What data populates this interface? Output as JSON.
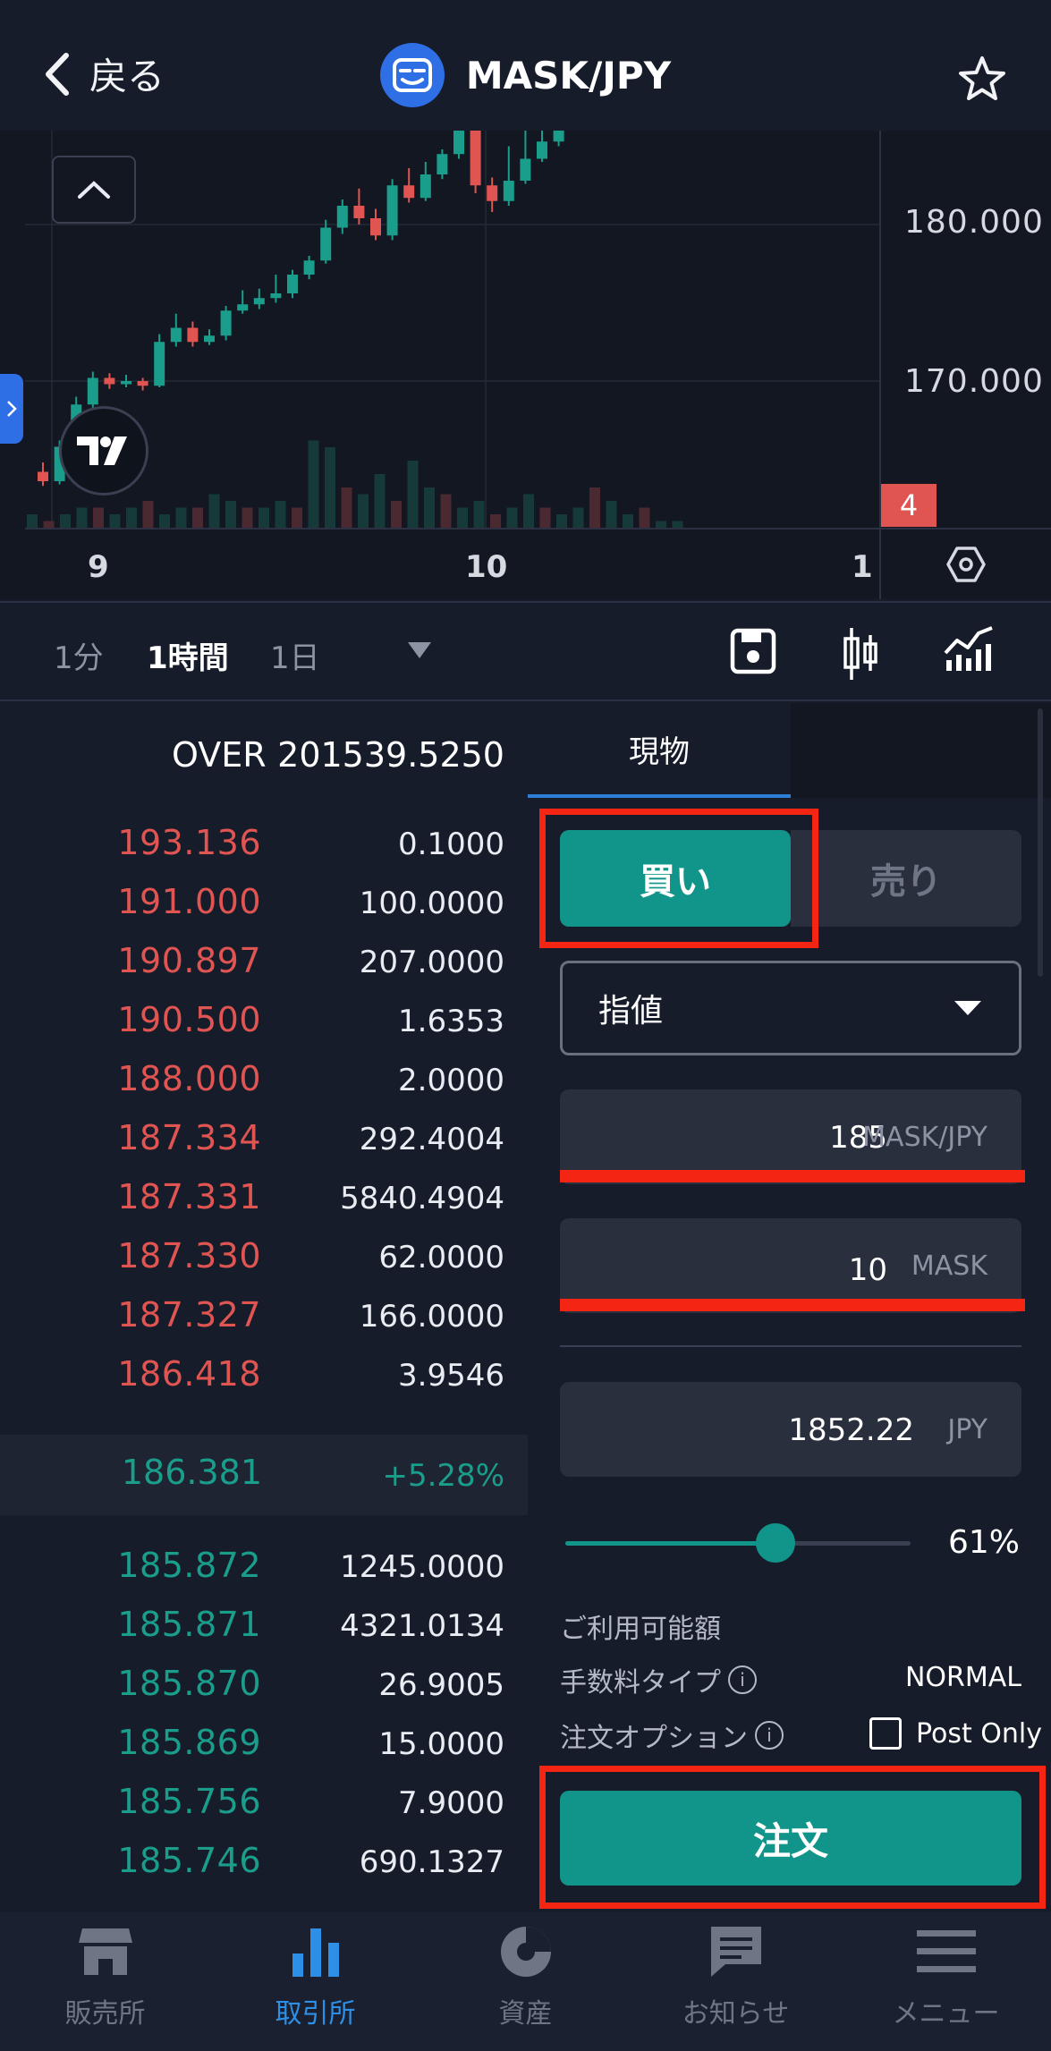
{
  "header": {
    "back_label": "戻る",
    "pair": "MASK/JPY"
  },
  "chart": {
    "y_labels": [
      "180.000",
      "170.000"
    ],
    "x_labels": [
      "9",
      "10",
      "1"
    ],
    "last_price_tag": "4",
    "candles": [
      {
        "o": 164.2,
        "c": 163.6,
        "h": 164.8,
        "l": 163.3
      },
      {
        "o": 163.6,
        "c": 165.8,
        "h": 166.2,
        "l": 163.4
      },
      {
        "o": 165.8,
        "c": 168.5,
        "h": 169.0,
        "l": 165.5
      },
      {
        "o": 168.5,
        "c": 170.2,
        "h": 170.6,
        "l": 168.2
      },
      {
        "o": 170.2,
        "c": 169.8,
        "h": 170.5,
        "l": 169.5
      },
      {
        "o": 169.8,
        "c": 170.0,
        "h": 170.4,
        "l": 169.6
      },
      {
        "o": 170.0,
        "c": 169.7,
        "h": 170.2,
        "l": 169.4
      },
      {
        "o": 169.7,
        "c": 172.5,
        "h": 173.0,
        "l": 169.6
      },
      {
        "o": 172.5,
        "c": 173.4,
        "h": 174.3,
        "l": 172.2
      },
      {
        "o": 173.4,
        "c": 172.5,
        "h": 173.8,
        "l": 172.2
      },
      {
        "o": 172.5,
        "c": 172.9,
        "h": 173.3,
        "l": 172.3
      },
      {
        "o": 172.9,
        "c": 174.5,
        "h": 174.8,
        "l": 172.6
      },
      {
        "o": 174.5,
        "c": 174.9,
        "h": 175.8,
        "l": 174.3
      },
      {
        "o": 174.9,
        "c": 175.3,
        "h": 175.9,
        "l": 174.6
      },
      {
        "o": 175.3,
        "c": 175.6,
        "h": 176.8,
        "l": 175.0
      },
      {
        "o": 175.6,
        "c": 176.8,
        "h": 177.1,
        "l": 175.3
      },
      {
        "o": 176.8,
        "c": 177.7,
        "h": 178.0,
        "l": 176.5
      },
      {
        "o": 177.7,
        "c": 179.8,
        "h": 180.3,
        "l": 177.5
      },
      {
        "o": 179.8,
        "c": 181.2,
        "h": 181.6,
        "l": 179.4
      },
      {
        "o": 181.2,
        "c": 180.4,
        "h": 182.3,
        "l": 180.0
      },
      {
        "o": 180.4,
        "c": 179.3,
        "h": 181.0,
        "l": 179.0
      },
      {
        "o": 179.3,
        "c": 182.5,
        "h": 182.9,
        "l": 179.0
      },
      {
        "o": 182.5,
        "c": 181.7,
        "h": 183.6,
        "l": 181.4
      },
      {
        "o": 181.7,
        "c": 183.2,
        "h": 184.0,
        "l": 181.5
      },
      {
        "o": 183.2,
        "c": 184.5,
        "h": 184.8,
        "l": 182.9
      },
      {
        "o": 184.5,
        "c": 186.3,
        "h": 186.9,
        "l": 184.2
      },
      {
        "o": 186.3,
        "c": 182.5,
        "h": 186.8,
        "l": 182.0
      },
      {
        "o": 182.5,
        "c": 181.5,
        "h": 183.0,
        "l": 180.8
      },
      {
        "o": 181.5,
        "c": 182.8,
        "h": 185.0,
        "l": 181.2
      },
      {
        "o": 182.8,
        "c": 184.2,
        "h": 186.0,
        "l": 182.6
      },
      {
        "o": 184.2,
        "c": 185.3,
        "h": 186.3,
        "l": 184.0
      },
      {
        "o": 185.3,
        "c": 186.4,
        "h": 187.0,
        "l": 185.0
      }
    ],
    "volumes": [
      2,
      1,
      2,
      3,
      3,
      2,
      3,
      4,
      2,
      3,
      3,
      5,
      4,
      3,
      3,
      4,
      3,
      13,
      12,
      6,
      5,
      8,
      4,
      10,
      6,
      5,
      3,
      4,
      2,
      3,
      5,
      3,
      2,
      3,
      6,
      4,
      2,
      3,
      1,
      1
    ]
  },
  "timeframes": {
    "items": [
      "1分",
      "1時間",
      "1日"
    ],
    "active": "1時間"
  },
  "orderbook": {
    "over_label": "OVER",
    "over_value": "201539.5250",
    "asks": [
      {
        "price": "193.136",
        "amount": "0.1000"
      },
      {
        "price": "191.000",
        "amount": "100.0000"
      },
      {
        "price": "190.897",
        "amount": "207.0000"
      },
      {
        "price": "190.500",
        "amount": "1.6353"
      },
      {
        "price": "188.000",
        "amount": "2.0000"
      },
      {
        "price": "187.334",
        "amount": "292.4004"
      },
      {
        "price": "187.331",
        "amount": "5840.4904"
      },
      {
        "price": "187.330",
        "amount": "62.0000"
      },
      {
        "price": "187.327",
        "amount": "166.0000"
      },
      {
        "price": "186.418",
        "amount": "3.9546"
      }
    ],
    "last_price": "186.381",
    "change": "+5.28%",
    "bids": [
      {
        "price": "185.872",
        "amount": "1245.0000"
      },
      {
        "price": "185.871",
        "amount": "4321.0134"
      },
      {
        "price": "185.870",
        "amount": "26.9005"
      },
      {
        "price": "185.869",
        "amount": "15.0000"
      },
      {
        "price": "185.756",
        "amount": "7.9000"
      },
      {
        "price": "185.746",
        "amount": "690.1327"
      }
    ]
  },
  "order_form": {
    "tab_label": "現物",
    "buy_label": "買い",
    "sell_label": "売り",
    "order_type": "指値",
    "price_value": "185",
    "price_unit": "MASK/JPY",
    "qty_value": "10",
    "qty_unit": "MASK",
    "total_value": "1852.22",
    "total_unit": "JPY",
    "slider_percent": 61,
    "slider_label": "61%",
    "available_label": "ご利用可能額",
    "fee_type_label": "手数料タイプ",
    "fee_type_value": "NORMAL",
    "order_option_label": "注文オプション",
    "post_only_label": "Post Only",
    "submit_label": "注文"
  },
  "nav": {
    "items": [
      {
        "label": "販売所",
        "icon": "store-icon"
      },
      {
        "label": "取引所",
        "icon": "bar-chart-icon"
      },
      {
        "label": "資産",
        "icon": "pie-chart-icon"
      },
      {
        "label": "お知らせ",
        "icon": "message-icon"
      },
      {
        "label": "メニュー",
        "icon": "menu-icon"
      }
    ],
    "active": "取引所"
  },
  "colors": {
    "up": "#1a9e8b",
    "down": "#e05552",
    "accent": "#11958a",
    "highlight": "#f42613",
    "nav_active": "#2e8fe6"
  }
}
